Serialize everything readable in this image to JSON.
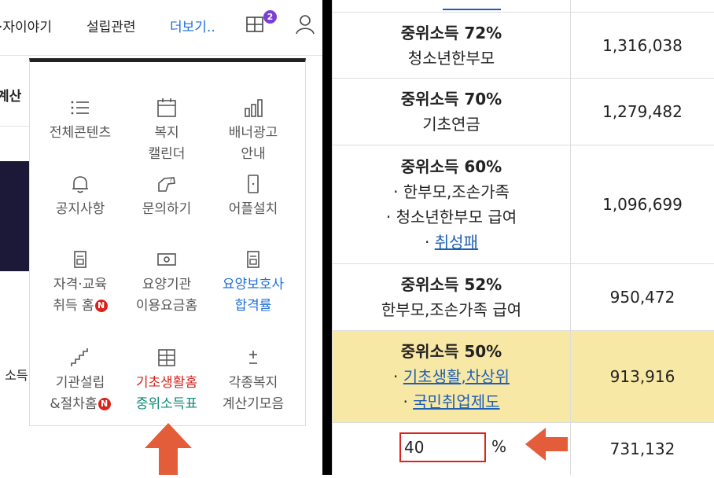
{
  "nav": {
    "items": [
      "·자이야기",
      "설립관련",
      "더보기.."
    ],
    "badge": "2"
  },
  "left_partial": {
    "tab_fragment": "계산 ",
    "side_fragment": "· 소득"
  },
  "menu": {
    "items": [
      {
        "icon": "list-icon",
        "lines": [
          "전체콘텐츠"
        ]
      },
      {
        "icon": "calendar-icon",
        "lines": [
          "복지",
          "캘린더"
        ]
      },
      {
        "icon": "bar-chart-icon",
        "lines": [
          "배너광고",
          "안내"
        ]
      },
      {
        "icon": "bell-icon",
        "lines": [
          "공지사항"
        ]
      },
      {
        "icon": "hand-question-icon",
        "lines": [
          "문의하기"
        ]
      },
      {
        "icon": "phone-icon",
        "lines": [
          "어플설치"
        ]
      },
      {
        "icon": "document-icon",
        "lines": [
          "자격·교육",
          "취득 홈"
        ],
        "badge": "N"
      },
      {
        "icon": "money-icon",
        "lines": [
          "요양기관",
          "이용요금홈"
        ]
      },
      {
        "icon": "document-icon",
        "lines": [
          "요양보호사",
          "합격률"
        ]
      },
      {
        "icon": "stairs-icon",
        "lines": [
          "기관설립",
          "&절차홈"
        ],
        "badge": "N"
      },
      {
        "icon": "table-icon",
        "lines": [
          "기초생활홈",
          "중위소득표"
        ]
      },
      {
        "icon": "plus-minus-icon",
        "lines": [
          "각종복지",
          "계산기모음"
        ]
      }
    ]
  },
  "table": {
    "rows": [
      {
        "title": "중위소득 72%",
        "subs": [
          "청소년한부모"
        ],
        "amount": "1,316,038"
      },
      {
        "title": "중위소득 70%",
        "subs": [
          "기초연금"
        ],
        "amount": "1,279,482"
      },
      {
        "title": "중위소득 60%",
        "subs": [
          "· 한부모,조손가족",
          "· 청소년한부모 급여"
        ],
        "link_prefix": "· ",
        "link": "취성패",
        "amount": "1,096,699"
      },
      {
        "title": "중위소득 52%",
        "subs": [
          "한부모,조손가족 급여"
        ],
        "amount": "950,472"
      },
      {
        "title": "중위소득 50%",
        "link_lines": [
          {
            "prefix": "· ",
            "links": [
              "기초생활",
              "차상위"
            ],
            "sep": ","
          },
          {
            "prefix": "· ",
            "links": [
              "국민취업제도"
            ]
          }
        ],
        "amount": "913,916"
      }
    ],
    "input_row": {
      "value": "40",
      "unit": "%",
      "amount": "731,132"
    }
  },
  "colors": {
    "accent": "#1e6fd9",
    "highlight": "#f8e8a6",
    "arrow": "#e35d3a",
    "badge": "#d9231c",
    "purple": "#7b3fd4"
  }
}
